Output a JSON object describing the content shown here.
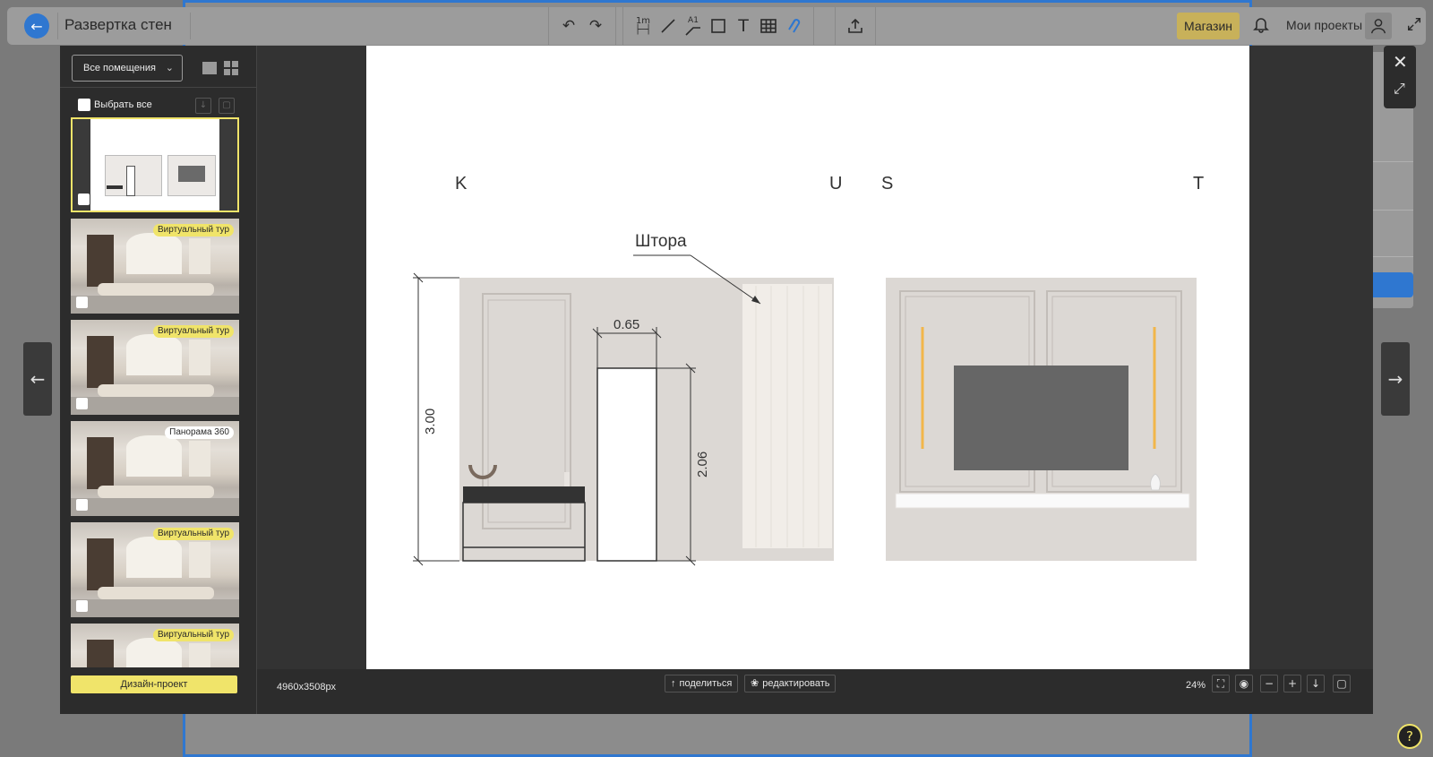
{
  "app": {
    "title": "Развертка стен",
    "shop_label": "Магазин",
    "my_projects_label": "Мои проекты"
  },
  "toolbar": {
    "tools": [
      "undo-icon",
      "redo-icon",
      "ruler-1m-icon",
      "line-icon",
      "angle-icon",
      "rectangle-icon",
      "text-icon",
      "table-icon",
      "magnet-icon"
    ],
    "ruler_label": "1m",
    "angle_label": "A1"
  },
  "panel": {
    "room_select": "Все помещения",
    "select_all_label": "Выбрать все",
    "thumbnails": [
      {
        "badge": ""
      },
      {
        "badge": "Виртуальный тур"
      },
      {
        "badge": "Виртуальный тур"
      },
      {
        "badge": "Панорама 360"
      },
      {
        "badge": "Виртуальный тур"
      },
      {
        "badge": "Виртуальный тур"
      }
    ],
    "design_button": "Дизайн-проект"
  },
  "drawing": {
    "labels": {
      "k": "K",
      "u": "U",
      "s": "S",
      "t": "T"
    },
    "curtain_label": "Штора",
    "dim_height": "3.00",
    "dim_door_width": "0.65",
    "dim_door_height": "2.06"
  },
  "footer": {
    "dimensions": "4960x3508px",
    "share_label": "поделиться",
    "edit_label": "редактировать",
    "zoom": "24%"
  },
  "colors": {
    "accent": "#2f77d0",
    "highlight": "#f0e46a",
    "wall": "#dcd8d4",
    "tv": "#666666"
  }
}
